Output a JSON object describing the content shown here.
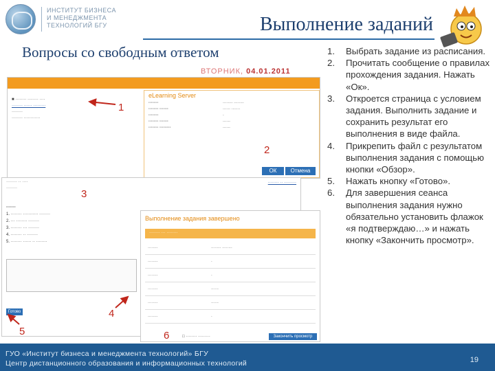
{
  "header": {
    "logo_text": "ИНСТИТУТ БИЗНЕСА\nИ МЕНЕДЖМЕНТА\nТЕХНОЛОГИЙ БГУ",
    "title": "Выполнение заданий",
    "subtitle": "Вопросы со свободным ответом"
  },
  "screens": {
    "date_weekday": "ВТОРНИК,",
    "date_value": "04.01.2011",
    "panel_title": "eLearning Server",
    "ok_label": "ОК",
    "cancel_label": "Отмена",
    "done_label": "Готово",
    "result_header": "Выполнение задания завершено",
    "close_label": "Закончить просмотр"
  },
  "steps": [
    "1",
    "2",
    "3",
    "4",
    "5",
    "6"
  ],
  "instructions": [
    {
      "n": "1.",
      "text": "Выбрать задание из расписания."
    },
    {
      "n": "2.",
      "text": "Прочитать сообщение о правилах прохождения задания. Нажать «Ок»."
    },
    {
      "n": "3.",
      "text": "Откроется страница с условием задания. Выполнить задание и сохранить результат его выполнения в виде файла."
    },
    {
      "n": "4.",
      "text": "Прикрепить файл с результатом выполнения задания с помощью кнопки «Обзор»."
    },
    {
      "n": "5.",
      "text": "Нажать кнопку «Готово»."
    },
    {
      "n": "6.",
      "text": "Для завершения сеанса выполнения задания нужно обязательно установить флажок «я подтверждаю…» и нажать кнопку «Закончить просмотр»."
    }
  ],
  "footer": {
    "text": "ГУО «Институт бизнеса и менеджмента технологий» БГУ\nЦентр дистанционного образования и информационных технологий",
    "page": "19"
  },
  "colors": {
    "title": "#1d3f6e",
    "footer_bg": "#1f5a92",
    "step_marker": "#c0261b",
    "accent_orange": "#f39b1f"
  }
}
